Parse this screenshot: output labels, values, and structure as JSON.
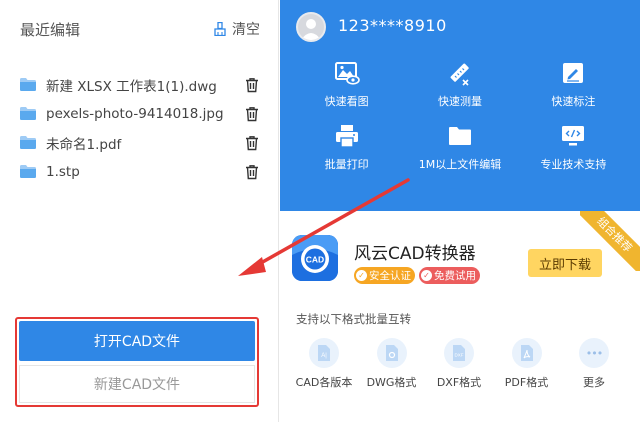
{
  "recent": {
    "title": "最近编辑",
    "clear_label": "清空",
    "files": [
      {
        "name": "新建 XLSX 工作表1(1).dwg"
      },
      {
        "name": "pexels-photo-9414018.jpg"
      },
      {
        "name": "未命名1.pdf"
      },
      {
        "name": "1.stp"
      }
    ]
  },
  "actions": {
    "open_label": "打开CAD文件",
    "new_label": "新建CAD文件"
  },
  "user": {
    "name": "123****8910"
  },
  "tools": [
    {
      "label": "快速看图",
      "icon": "image-view-icon"
    },
    {
      "label": "快速测量",
      "icon": "measure-icon"
    },
    {
      "label": "快速标注",
      "icon": "annotate-icon"
    },
    {
      "label": "批量打印",
      "icon": "printer-icon"
    },
    {
      "label": "1M以上文件编辑",
      "icon": "folder-icon"
    },
    {
      "label": "专业技术支持",
      "icon": "code-support-icon"
    }
  ],
  "promo": {
    "logo_text": "CAD",
    "app_name": "风云CAD转换器",
    "badge_safe": "安全认证",
    "badge_free": "免费试用",
    "download_label": "立即下载",
    "ribbon_text": "组合推荐",
    "support_text": "支持以下格式批量互转",
    "formats": [
      {
        "label": "CAD各版本",
        "icon_text": "A|"
      },
      {
        "label": "DWG格式",
        "icon_text": ""
      },
      {
        "label": "DXF格式",
        "icon_text": "DXF"
      },
      {
        "label": "PDF格式",
        "icon_text": ""
      },
      {
        "label": "更多",
        "icon_text": "•••"
      }
    ]
  },
  "colors": {
    "primary_blue": "#2f87e6",
    "highlight_red": "#e53935",
    "download_yellow": "#ffd561",
    "ribbon_gold": "#f0b52f"
  }
}
